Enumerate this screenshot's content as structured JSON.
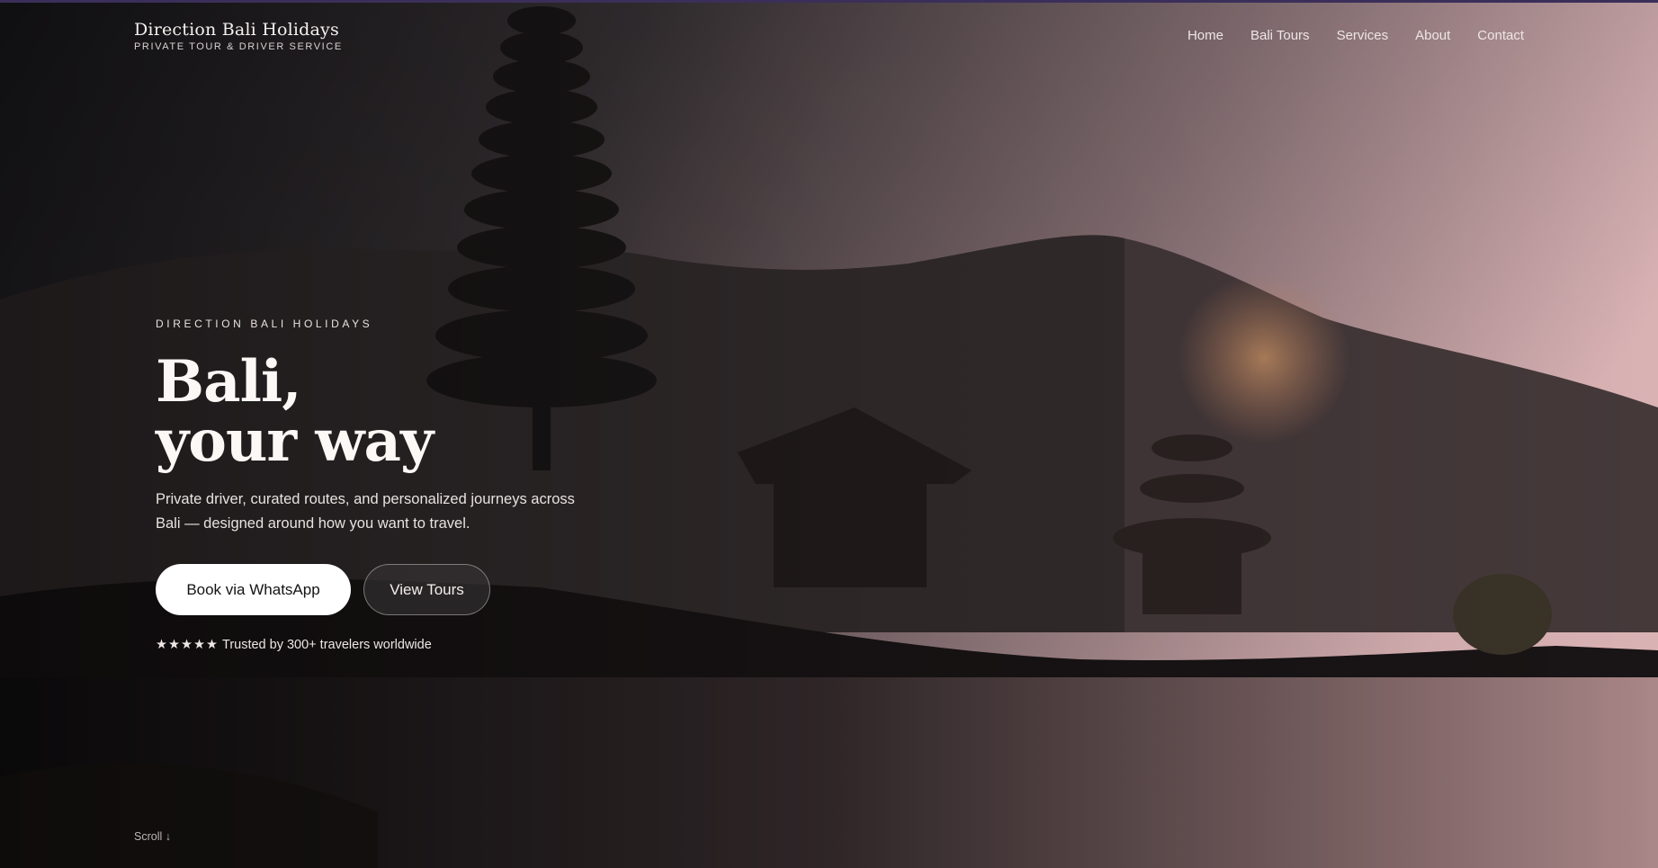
{
  "header": {
    "brand_name": "Direction Bali Holidays",
    "brand_tagline": "PRIVATE TOUR & DRIVER SERVICE",
    "nav": [
      "Home",
      "Bali Tours",
      "Services",
      "About",
      "Contact"
    ]
  },
  "hero": {
    "eyebrow": "DIRECTION BALI HOLIDAYS",
    "headline_line1": "Bali,",
    "headline_line2": "your way",
    "subtitle": "Private driver, curated routes, and personalized journeys across Bali — designed around how you want to travel.",
    "primary_button": "Book via WhatsApp",
    "secondary_button": "View Tours",
    "rating_stars": "★★★★★",
    "trust_text": "Trusted by 300+ travelers worldwide",
    "scroll_hint": "Scroll ↓"
  },
  "background_image": "lake temple with tiered pagoda roofs at sunset",
  "colors": {
    "accent_top_border": "#3b2f5a",
    "primary_button_bg": "#ffffff",
    "text_light": "#fbf8f5"
  }
}
